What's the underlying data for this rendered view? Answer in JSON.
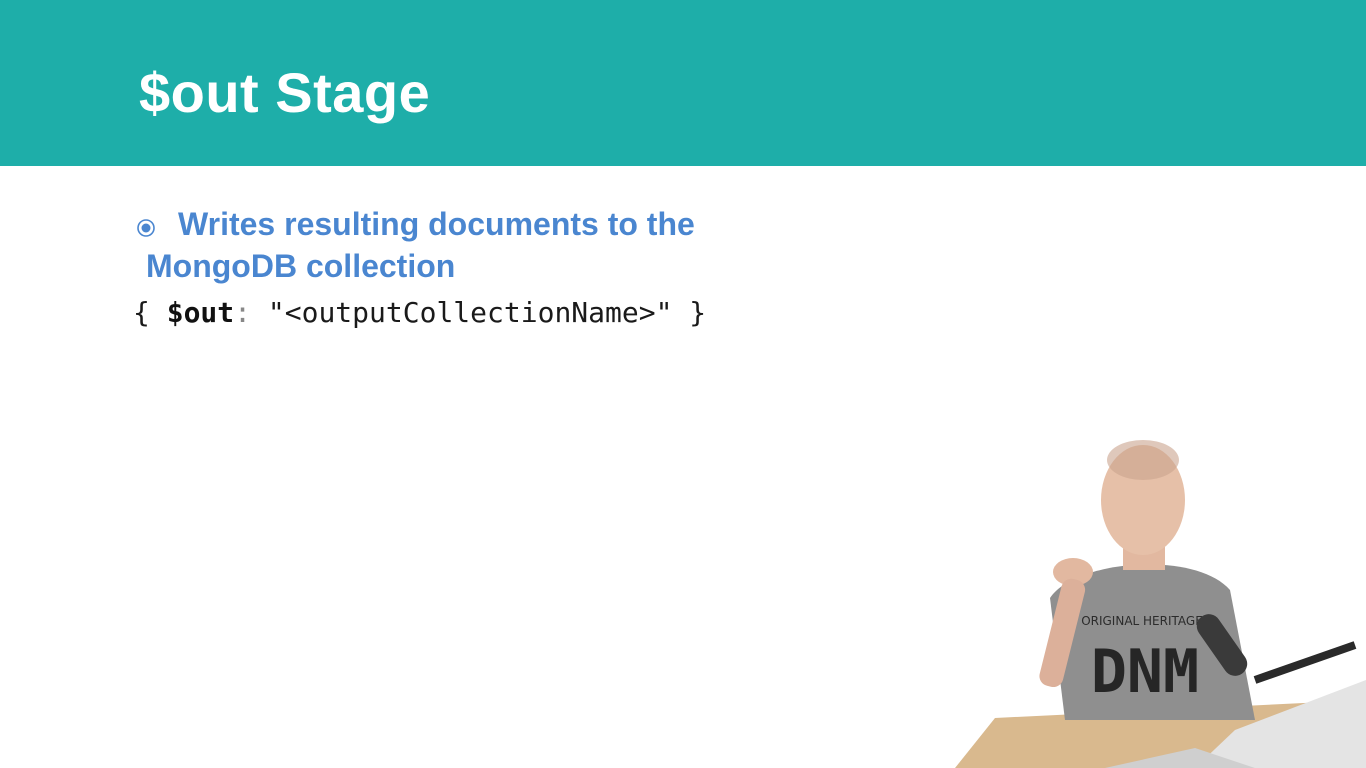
{
  "slide": {
    "title": "$out Stage",
    "bullet": {
      "text": "Writes resulting documents to the MongoDB collection",
      "icon": "radio-bullet-icon"
    },
    "code": {
      "open": "{ ",
      "key": "$out",
      "colon": ":",
      "value": " \"<outputCollectionName>\" }"
    }
  },
  "webcam": {
    "shirt_text_top": "ORIGINAL HERITAGE",
    "shirt_text_big": "DNM"
  },
  "colors": {
    "header": "#1eaea9",
    "title": "#ffffff",
    "bullet": "#4a86d0",
    "code": "#1a1a1a"
  }
}
